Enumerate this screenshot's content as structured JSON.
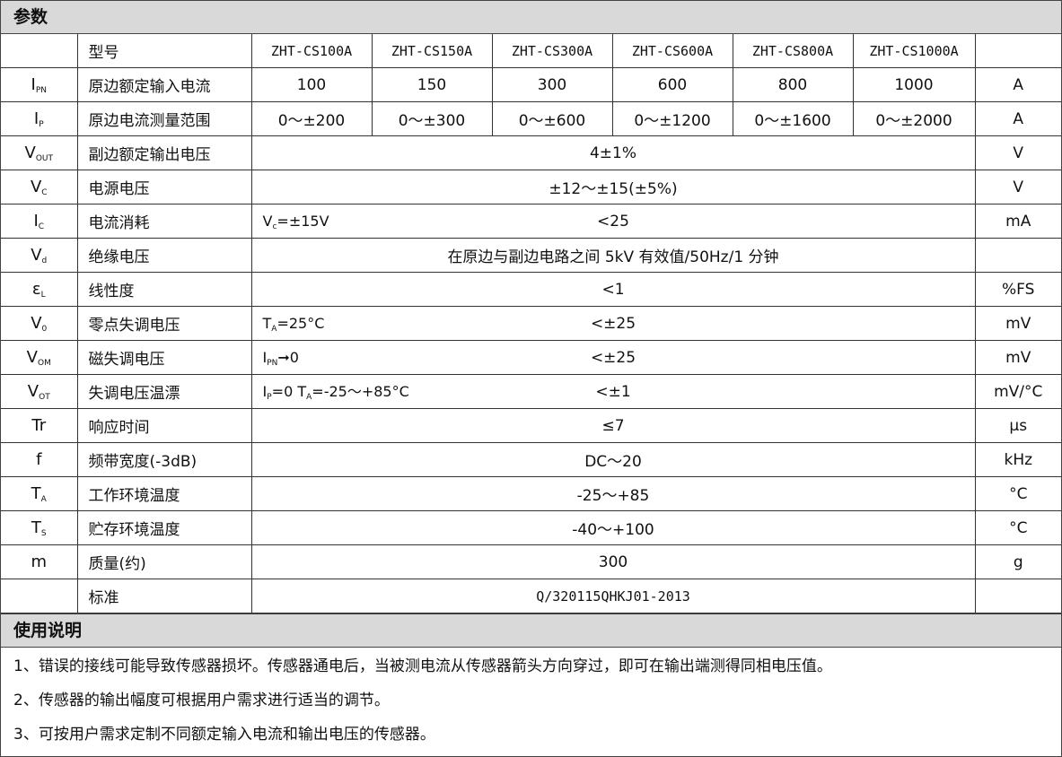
{
  "params_title": "参数",
  "usage_title": "使用说明",
  "models": [
    "ZHT-CS100A",
    "ZHT-CS150A",
    "ZHT-CS300A",
    "ZHT-CS600A",
    "ZHT-CS800A",
    "ZHT-CS1000A"
  ],
  "model_label": "型号",
  "rows": [
    {
      "sym": "I",
      "sub": "PN",
      "name": "原边额定输入电流",
      "values": [
        "100",
        "150",
        "300",
        "600",
        "800",
        "1000"
      ],
      "unit": "A"
    },
    {
      "sym": "I",
      "sub": "P",
      "name": "原边电流测量范围",
      "values": [
        "0～±200",
        "0～±300",
        "0～±600",
        "0～±1200",
        "0～±1600",
        "0～±2000"
      ],
      "unit": "A"
    },
    {
      "sym": "V",
      "sub": "OUT",
      "name": "副边额定输出电压",
      "value": "4±1%",
      "unit": "V"
    },
    {
      "sym": "V",
      "sub": "C",
      "name": "电源电压",
      "value": "±12～±15(±5%)",
      "unit": "V"
    },
    {
      "sym": "I",
      "sub": "C",
      "name": "电流消耗",
      "cond": "V",
      "cond_sub": "c",
      "cond_rest": "=±15V",
      "value": "<25",
      "unit": "mA"
    },
    {
      "sym": "V",
      "sub": "d",
      "name": "绝缘电压",
      "value": "在原边与副边电路之间 5kV 有效值/50Hz/1 分钟",
      "unit": ""
    },
    {
      "sym": "ε",
      "sub": "L",
      "name": "线性度",
      "value": "<1",
      "unit": "%FS"
    },
    {
      "sym": "V",
      "sub": "0",
      "name": "零点失调电压",
      "cond": "T",
      "cond_sub": "A",
      "cond_rest": "=25°C",
      "value": "<±25",
      "unit": "mV"
    },
    {
      "sym": "V",
      "sub": "OM",
      "name": "磁失调电压",
      "cond": "I",
      "cond_sub": "PN",
      "cond_rest": "➞0",
      "value": "<±25",
      "unit": "mV"
    },
    {
      "sym": "V",
      "sub": "OT",
      "name": "失调电压温漂",
      "cond": "I",
      "cond_sub": "P",
      "cond_rest": "=0   T",
      "cond_sub2": "A",
      "cond_rest2": "=-25～+85°C",
      "value": "<±1",
      "unit": "mV/°C"
    },
    {
      "sym": "Tr",
      "sub": "",
      "name": "响应时间",
      "value": "≤7",
      "unit": "μs"
    },
    {
      "sym": "f",
      "sub": "",
      "name": "频带宽度(-3dB)",
      "value": "DC～20",
      "unit": "kHz"
    },
    {
      "sym": "T",
      "sub": "A",
      "name": "工作环境温度",
      "value": "-25～+85",
      "unit": "°C"
    },
    {
      "sym": "T",
      "sub": "S",
      "name": "贮存环境温度",
      "value": "-40～+100",
      "unit": "°C"
    },
    {
      "sym": "m",
      "sub": "",
      "name": "质量(约)",
      "value": "300",
      "unit": "g"
    },
    {
      "sym": "",
      "sub": "",
      "name": "标准",
      "value": "Q/320115QHKJ01-2013",
      "unit": ""
    }
  ],
  "usage": [
    "1、错误的接线可能导致传感器损坏。传感器通电后，当被测电流从传感器箭头方向穿过，即可在输出端测得同相电压值。",
    "2、传感器的输出幅度可根据用户需求进行适当的调节。",
    "3、可按用户需求定制不同额定输入电流和输出电压的传感器。"
  ]
}
